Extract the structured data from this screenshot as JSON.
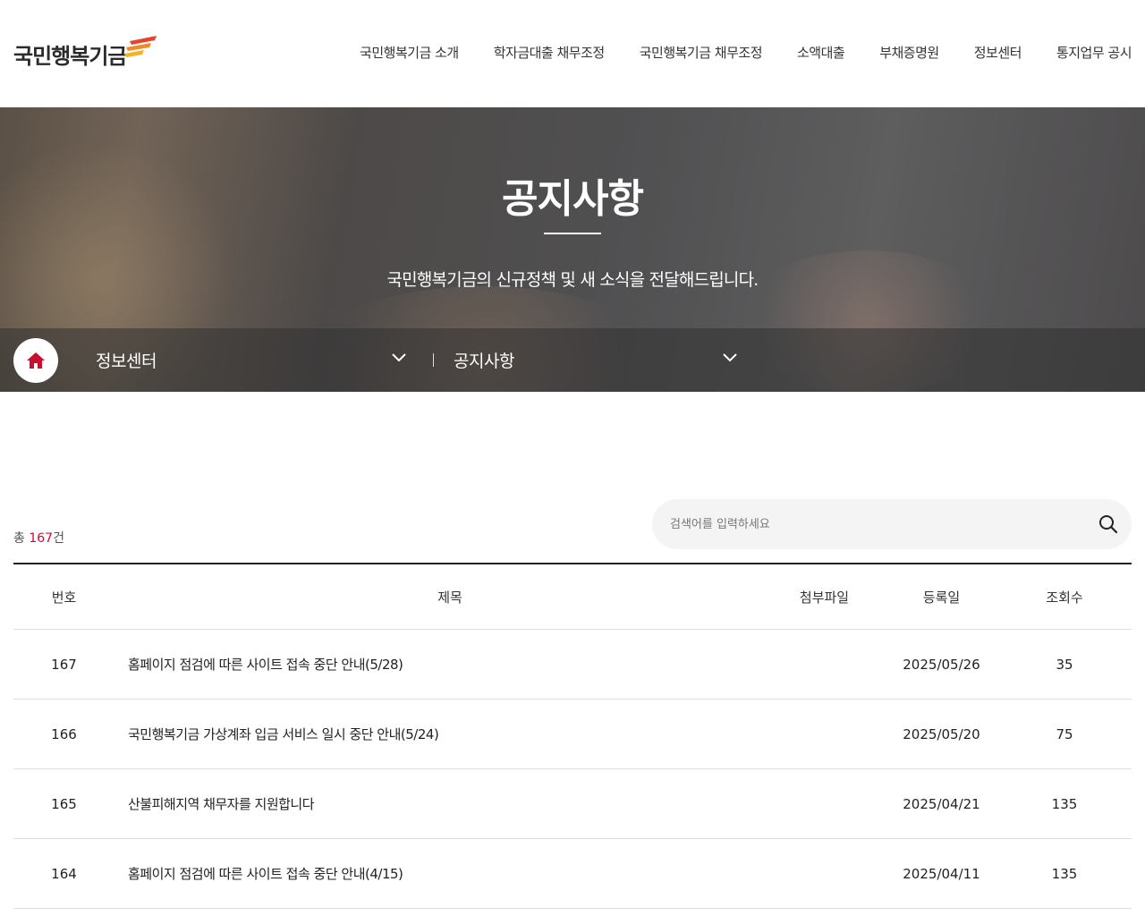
{
  "header": {
    "logo_text": "국민행복기금",
    "nav": [
      "국민행복기금 소개",
      "학자금대출 채무조정",
      "국민행복기금 채무조정",
      "소액대출",
      "부채증명원",
      "정보센터",
      "통지업무 공시"
    ]
  },
  "hero": {
    "title": "공지사항",
    "subtitle": "국민행복기금의 신규정책 및 새 소식을 전달해드립니다."
  },
  "location": {
    "home_icon": "home-icon",
    "depth1": "정보센터",
    "depth2": "공지사항"
  },
  "board": {
    "count_prefix": "총",
    "count": "167",
    "count_suffix": "건",
    "search_placeholder": "검색어를 입력하세요",
    "columns": [
      "번호",
      "제목",
      "첨부파일",
      "등록일",
      "조회수"
    ],
    "rows": [
      {
        "no": "167",
        "title": "홈페이지 점검에 따른 사이트 접속 중단 안내(5/28)",
        "file": "",
        "date": "2025/05/26",
        "views": "35"
      },
      {
        "no": "166",
        "title": "국민행복기금 가상계좌 입금 서비스 일시 중단 안내(5/24)",
        "file": "",
        "date": "2025/05/20",
        "views": "75"
      },
      {
        "no": "165",
        "title": "산불피해지역 채무자를 지원합니다",
        "file": "",
        "date": "2025/04/21",
        "views": "135"
      },
      {
        "no": "164",
        "title": "홈페이지 점검에 따른 사이트 접속 중단 안내(4/15)",
        "file": "",
        "date": "2025/04/11",
        "views": "135"
      }
    ]
  },
  "colors": {
    "accent": "#c8102e",
    "logo_stripes": [
      "#e8412c",
      "#f08a24",
      "#f5b323"
    ]
  }
}
